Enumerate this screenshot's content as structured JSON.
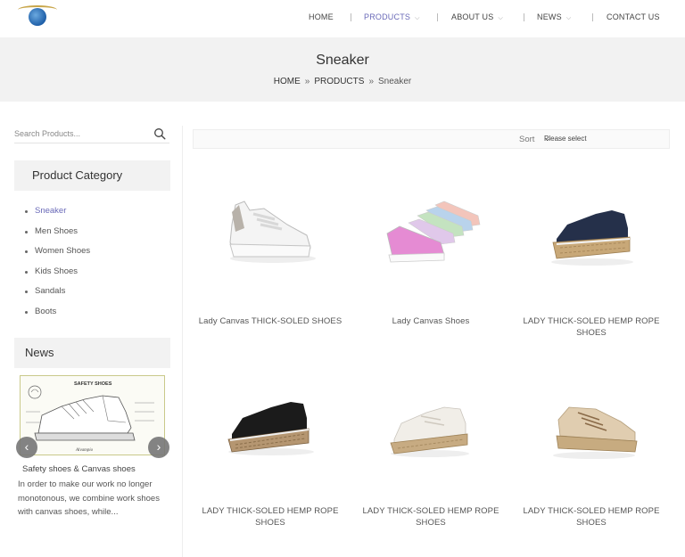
{
  "logo": {
    "name": "company-logo"
  },
  "nav": {
    "items": [
      {
        "label": "HOME",
        "has_dropdown": false
      },
      {
        "label": "PRODUCTS",
        "has_dropdown": true,
        "active": true
      },
      {
        "label": "ABOUT US",
        "has_dropdown": true
      },
      {
        "label": "NEWS",
        "has_dropdown": true
      },
      {
        "label": "CONTACT US",
        "has_dropdown": false
      }
    ]
  },
  "banner": {
    "title": "Sneaker",
    "breadcrumb": [
      "HOME",
      "PRODUCTS",
      "Sneaker"
    ],
    "separator": "»"
  },
  "sidebar": {
    "search": {
      "placeholder": "Search Products..."
    },
    "category": {
      "heading": "Product Category",
      "items": [
        {
          "label": "Sneaker",
          "active": true
        },
        {
          "label": "Men Shoes"
        },
        {
          "label": "Women Shoes"
        },
        {
          "label": "Kids Shoes"
        },
        {
          "label": "Sandals"
        },
        {
          "label": "Boots"
        }
      ]
    },
    "news": {
      "heading": "News",
      "image_heading": "SAFETY SHOES",
      "image_brand": "Alvampio",
      "prev_icon": "chevron-left-icon",
      "next_icon": "chevron-right-icon",
      "title": "Safety shoes & Canvas shoes",
      "excerpt": "In order to make our work no longer monotonous, we combine work shoes with canvas shoes, while..."
    }
  },
  "sort": {
    "label": "Sort",
    "selected": "Please select",
    "options": [
      "Please select"
    ]
  },
  "products": [
    {
      "name": "Lady Canvas THICK-SOLED SHOES",
      "image": "white-platform-sneaker"
    },
    {
      "name": "Lady Canvas Shoes",
      "image": "glitter-sneakers-set"
    },
    {
      "name": "LADY THICK-SOLED HEMP ROPE SHOES",
      "image": "navy-espadrille-sneaker"
    },
    {
      "name": "LADY THICK-SOLED HEMP ROPE SHOES",
      "image": "black-espadrille-sneaker"
    },
    {
      "name": "LADY THICK-SOLED HEMP ROPE SHOES",
      "image": "white-espadrille-sneaker"
    },
    {
      "name": "LADY THICK-SOLED HEMP ROPE SHOES",
      "image": "beige-espadrille-sneaker"
    }
  ],
  "colors": {
    "accent": "#6a6ab8",
    "banner_bg": "#f2f2f2",
    "panel_bg": "#f2f2f2"
  }
}
